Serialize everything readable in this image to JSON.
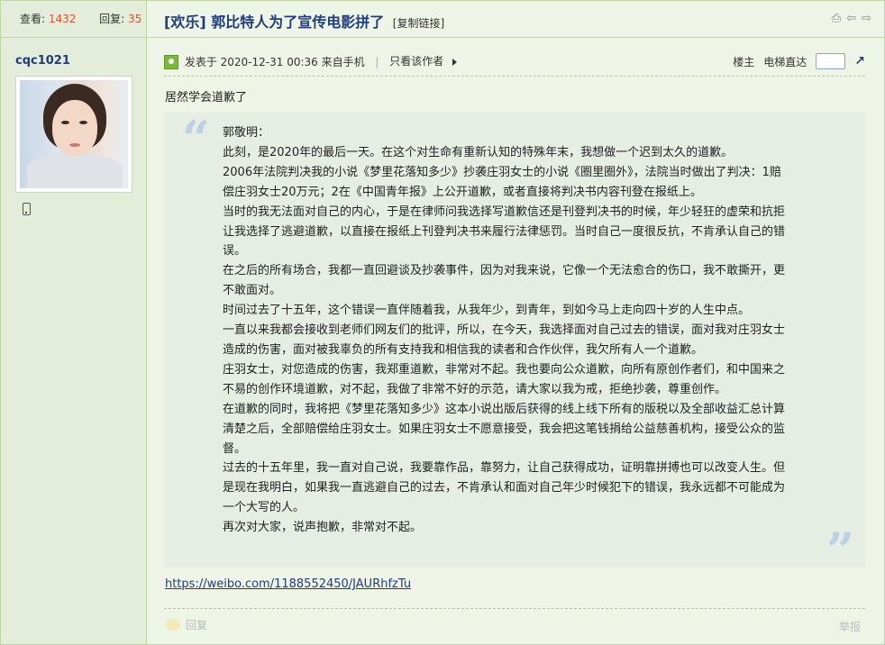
{
  "stats": {
    "views_label": "查看:",
    "views": "1432",
    "replies_label": "回复:",
    "replies": "35"
  },
  "thread": {
    "title": "[欢乐] 郭比特人为了宣传电影拼了",
    "copy_link": "[复制链接]"
  },
  "header_icons": [
    "print-icon",
    "prev-thread-icon",
    "next-thread-icon"
  ],
  "author": {
    "name": "cqc1021",
    "device_icon": "mobile-phone-icon"
  },
  "post_meta": {
    "posted": "发表于 2020-12-31 00:36 来自手机",
    "divider": "|",
    "only_author": "只看该作者",
    "floor": "楼主",
    "jump_label": "电梯直达",
    "jump_placeholder": ""
  },
  "lead_text": "居然学会道歉了",
  "quote_lines": [
    "郭敬明：",
    "此刻，是2020年的最后一天。在这个对生命有重新认知的特殊年末，我想做一个迟到太久的道歉。",
    "2006年法院判决我的小说《梦里花落知多少》抄袭庄羽女士的小说《圈里圈外》，法院当时做出了判决：1赔偿庄羽女士20万元；2在《中国青年报》上公开道歉，或者直接将判决书内容刊登在报纸上。",
    "当时的我无法面对自己的内心，于是在律师问我选择写道歉信还是刊登判决书的时候，年少轻狂的虚荣和抗拒让我选择了逃避道歉，以直接在报纸上刊登判决书来履行法律惩罚。当时自己一度很反抗，不肯承认自己的错误。",
    "在之后的所有场合，我都一直回避谈及抄袭事件，因为对我来说，它像一个无法愈合的伤口，我不敢撕开，更不敢面对。",
    "时间过去了十五年，这个错误一直伴随着我，从我年少，到青年，到如今马上走向四十岁的人生中点。",
    "一直以来我都会接收到老师们网友们的批评，所以，在今天，我选择面对自己过去的错误，面对我对庄羽女士造成的伤害，面对被我辜负的所有支持我和相信我的读者和合作伙伴，我欠所有人一个道歉。",
    "庄羽女士，对您造成的伤害，我郑重道歉，非常对不起。我也要向公众道歉，向所有原创作者们，和中国来之不易的创作环境道歉，对不起，我做了非常不好的示范，请大家以我为戒，拒绝抄袭，尊重创作。",
    "在道歉的同时，我将把《梦里花落知多少》这本小说出版后获得的线上线下所有的版税以及全部收益汇总计算清楚之后，全部赔偿给庄羽女士。如果庄羽女士不愿意接受，我会把这笔钱捐给公益慈善机构，接受公众的监督。",
    "过去的十五年里，我一直对自己说，我要靠作品，靠努力，让自己获得成功，证明靠拼搏也可以改变人生。但是现在我明白，如果我一直逃避自己的过去，不肯承认和面对自己年少时候犯下的错误，我永远都不可能成为一个大写的人。",
    "再次对大家，说声抱歉，非常对不起。"
  ],
  "link": "https://weibo.com/1188552450/JAURhfzTu",
  "actions": {
    "reply": "回复",
    "report": "举报"
  },
  "colors": {
    "accent": "#1f3d7a",
    "count": "#e2502e",
    "sidebar_bg": "#e4edda",
    "main_bg": "#eef4e6",
    "quote_bg": "#e6eee3"
  }
}
